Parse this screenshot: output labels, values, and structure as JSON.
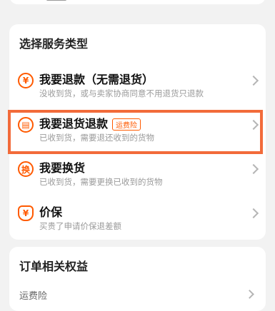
{
  "service_section": {
    "title": "选择服务类型",
    "options": [
      {
        "title": "我要退款（无需退货）",
        "subtitle": "没收到货，或与卖家协商同意不用退货只退款",
        "icon": "yuan-icon"
      },
      {
        "title": "我要退货退款",
        "tag": "运费险",
        "subtitle": "已收到货，需要退还收到的货物",
        "icon": "box-icon"
      },
      {
        "title": "我要换货",
        "subtitle": "已收到货，需要更换已收到的货物",
        "icon": "swap-icon"
      },
      {
        "title": "价保",
        "subtitle": "买贵了申请价保退差额",
        "icon": "shield-yuan-icon"
      }
    ]
  },
  "benefits_section": {
    "title": "订单相关权益",
    "first_item": "运费险"
  },
  "colors": {
    "accent": "#ff5a00",
    "highlight_border": "#f26b3a"
  }
}
